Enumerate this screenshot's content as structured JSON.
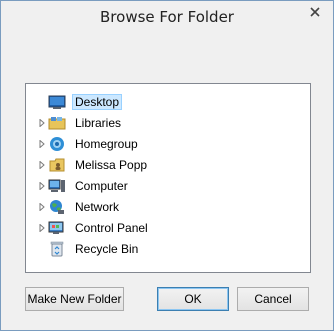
{
  "window": {
    "title": "Browse For Folder"
  },
  "tree": {
    "items": [
      {
        "label": "Desktop",
        "icon": "desktop-icon",
        "expandable": false,
        "selected": true
      },
      {
        "label": "Libraries",
        "icon": "libraries-icon",
        "expandable": true,
        "selected": false
      },
      {
        "label": "Homegroup",
        "icon": "homegroup-icon",
        "expandable": true,
        "selected": false
      },
      {
        "label": "Melissa Popp",
        "icon": "user-folder-icon",
        "expandable": true,
        "selected": false
      },
      {
        "label": "Computer",
        "icon": "computer-icon",
        "expandable": true,
        "selected": false
      },
      {
        "label": "Network",
        "icon": "network-icon",
        "expandable": true,
        "selected": false
      },
      {
        "label": "Control Panel",
        "icon": "control-panel-icon",
        "expandable": true,
        "selected": false
      },
      {
        "label": "Recycle Bin",
        "icon": "recycle-bin-icon",
        "expandable": false,
        "selected": false
      }
    ]
  },
  "buttons": {
    "make_new_folder": "Make New Folder",
    "ok": "OK",
    "cancel": "Cancel"
  },
  "colors": {
    "selection_fill": "#cce8ff",
    "selection_border": "#99d1ff",
    "default_button_border": "#3c7fb1"
  }
}
